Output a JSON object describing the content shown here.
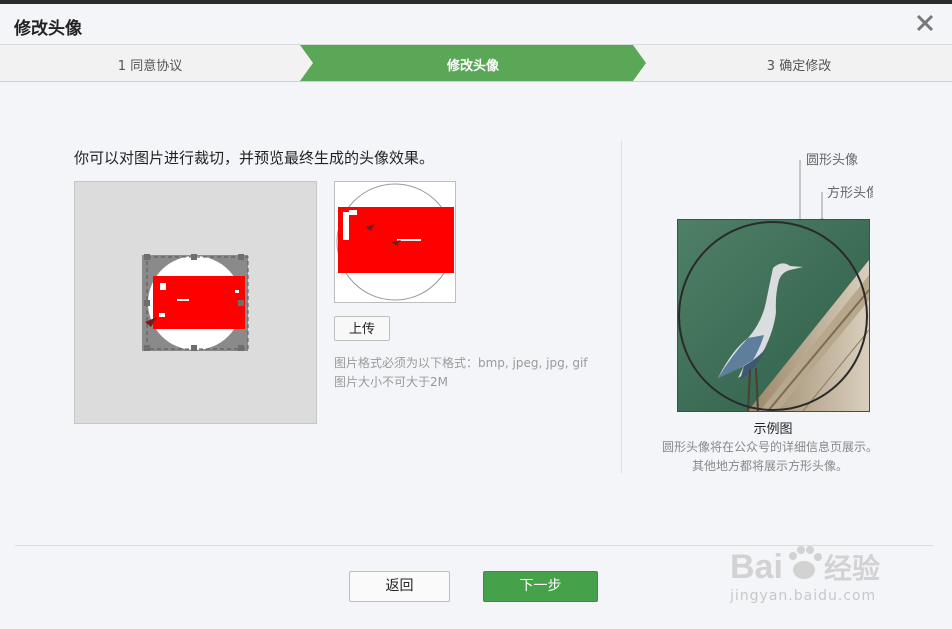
{
  "dialog": {
    "title": "修改头像"
  },
  "steps": [
    {
      "label": "1 同意协议"
    },
    {
      "label": "修改头像"
    },
    {
      "label": "3 确定修改"
    }
  ],
  "colors": {
    "active_step": "#5aa757",
    "primary_button": "#46a24a",
    "crop_fill": "#ff0000"
  },
  "editor": {
    "instruction": "你可以对图片进行裁切，并预览最终生成的头像效果。",
    "upload_label": "上传",
    "note_format": "图片格式必须为以下格式：bmp, jpeg, jpg, gif",
    "note_size": "图片大小不可大于2M"
  },
  "example": {
    "label_round": "圆形头像",
    "label_square": "方形头像",
    "caption": "示例图",
    "desc_line1": "圆形头像将在公众号的详细信息页展示。",
    "desc_line2": "其他地方都将展示方形头像。"
  },
  "footer": {
    "back_label": "返回",
    "next_label": "下一步"
  },
  "watermark": {
    "brand": "Bai",
    "brand_tail": "经验",
    "url": "jingyan.baidu.com"
  },
  "icons": {
    "close": "close-icon",
    "paw": "paw-icon"
  }
}
